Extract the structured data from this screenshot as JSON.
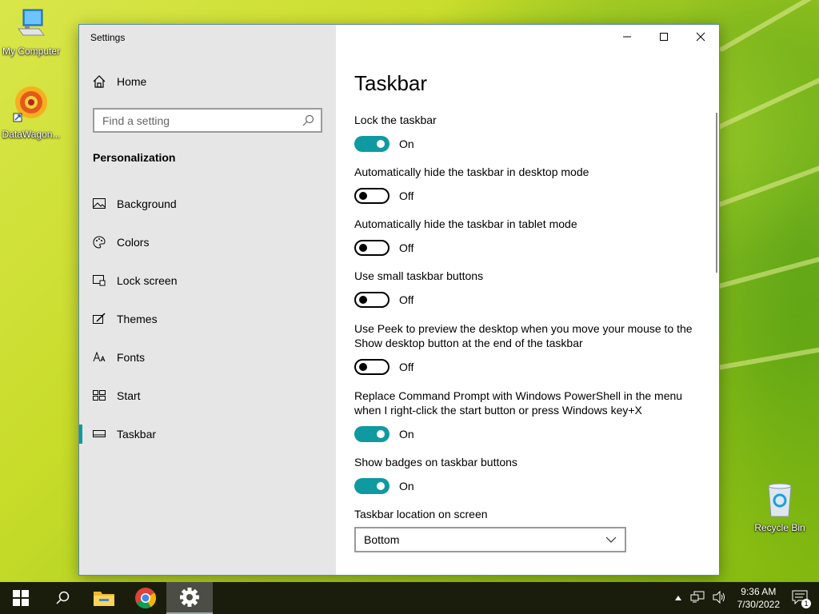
{
  "desktop": {
    "icons": [
      {
        "label": "My Computer"
      },
      {
        "label": "DataWagon..."
      },
      {
        "label": "Recycle Bin"
      }
    ]
  },
  "window": {
    "title": "Settings",
    "controls": {
      "minimize": "minimize-icon",
      "maximize": "maximize-icon",
      "close": "close-icon"
    }
  },
  "sidebar": {
    "home_label": "Home",
    "search_placeholder": "Find a setting",
    "section_title": "Personalization",
    "items": [
      {
        "label": "Background",
        "icon": "picture-icon"
      },
      {
        "label": "Colors",
        "icon": "palette-icon"
      },
      {
        "label": "Lock screen",
        "icon": "lock-screen-icon"
      },
      {
        "label": "Themes",
        "icon": "brush-icon"
      },
      {
        "label": "Fonts",
        "icon": "fonts-icon"
      },
      {
        "label": "Start",
        "icon": "start-tiles-icon"
      },
      {
        "label": "Taskbar",
        "icon": "taskbar-icon",
        "active": true
      }
    ]
  },
  "main": {
    "title": "Taskbar",
    "settings": [
      {
        "label": "Lock the taskbar",
        "state": "On"
      },
      {
        "label": "Automatically hide the taskbar in desktop mode",
        "state": "Off"
      },
      {
        "label": "Automatically hide the taskbar in tablet mode",
        "state": "Off"
      },
      {
        "label": "Use small taskbar buttons",
        "state": "Off"
      },
      {
        "label": "Use Peek to preview the desktop when you move your mouse to the Show desktop button at the end of the taskbar",
        "state": "Off"
      },
      {
        "label": "Replace Command Prompt with Windows PowerShell in the menu when I right-click the start button or press Windows key+X",
        "state": "On"
      },
      {
        "label": "Show badges on taskbar buttons",
        "state": "On"
      }
    ],
    "location": {
      "label": "Taskbar location on screen",
      "value": "Bottom"
    }
  },
  "taskbar": {
    "time": "9:36 AM",
    "date": "7/30/2022",
    "notification_count": "1",
    "accent": "#0e9aa0"
  }
}
